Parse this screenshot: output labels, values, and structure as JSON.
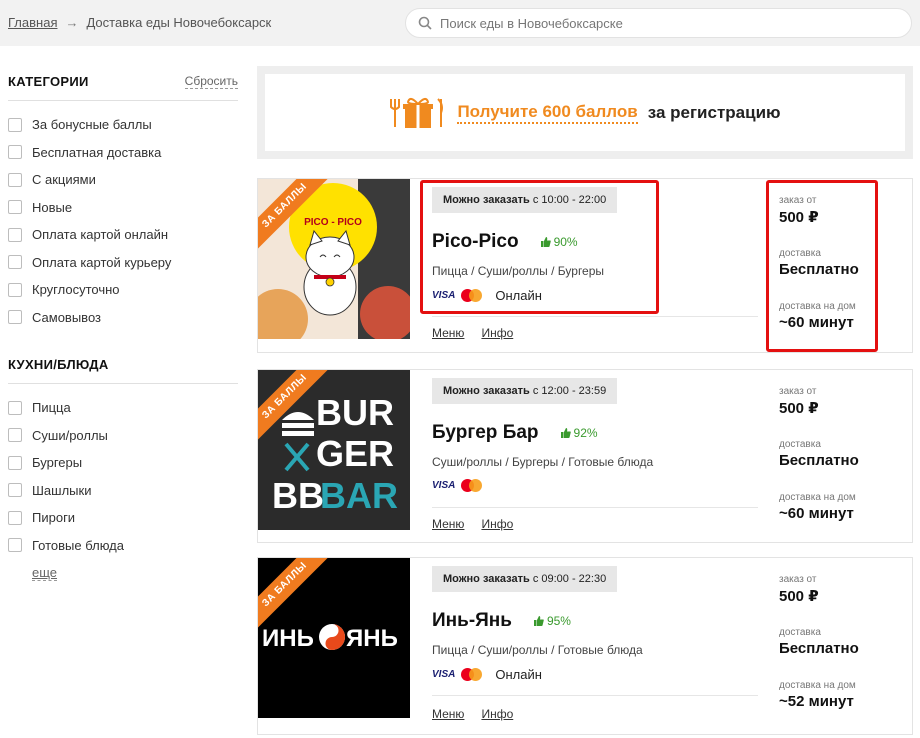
{
  "breadcrumb": {
    "home": "Главная",
    "arrow": "→",
    "current": "Доставка еды Новочебоксарск"
  },
  "search": {
    "placeholder": "Поиск еды в Новочебоксарске"
  },
  "sidebar": {
    "categories_title": "КАТЕГОРИИ",
    "reset_label": "Сбросить",
    "categories": [
      "За бонусные баллы",
      "Бесплатная доставка",
      "С акциями",
      "Новые",
      "Оплата картой онлайн",
      "Оплата картой курьеру",
      "Круглосуточно",
      "Самовывоз"
    ],
    "cuisines_title": "КУХНИ/БЛЮДА",
    "cuisines": [
      "Пицца",
      "Суши/роллы",
      "Бургеры",
      "Шашлыки",
      "Пироги",
      "Готовые блюда"
    ],
    "more_label": "еще"
  },
  "promo": {
    "link": "Получите 600 баллов",
    "rest": "за регистрацию"
  },
  "labels": {
    "order_from": "заказ от",
    "delivery": "доставка",
    "delivery_time": "доставка на дом",
    "menu": "Меню",
    "info": "Инфо",
    "ribbon": "ЗА БАЛЛЫ",
    "visa": "VISA",
    "hours_prefix": "Можно заказать"
  },
  "restaurants": [
    {
      "hours": "с 10:00 - 22:00",
      "name": "Pico-Pico",
      "rating": "90%",
      "cuisines": "Пицца / Суши/роллы / Бургеры",
      "payment": "Онлайн",
      "min_order": "500 ₽",
      "delivery": "Бесплатно",
      "time": "~60 минут",
      "logo_text": "PICO - PICO"
    },
    {
      "hours": "с 12:00 - 23:59",
      "name": "Бургер Бар",
      "rating": "92%",
      "cuisines": "Суши/роллы / Бургеры / Готовые блюда",
      "payment": "",
      "min_order": "500 ₽",
      "delivery": "Бесплатно",
      "time": "~60 минут",
      "logo_text": [
        "BUR",
        "GER",
        "BB",
        "BAR"
      ]
    },
    {
      "hours": "с 09:00 - 22:30",
      "name": "Инь-Янь",
      "rating": "95%",
      "cuisines": "Пицца / Суши/роллы / Готовые блюда",
      "payment": "Онлайн",
      "min_order": "500 ₽",
      "delivery": "Бесплатно",
      "time": "~52 минут",
      "logo_text": [
        "ИНЬ",
        "ЯНЬ"
      ]
    }
  ],
  "colors": {
    "accent": "#f08a1f",
    "rating_green": "#3a9a2e",
    "highlight_red": "#e41010"
  }
}
